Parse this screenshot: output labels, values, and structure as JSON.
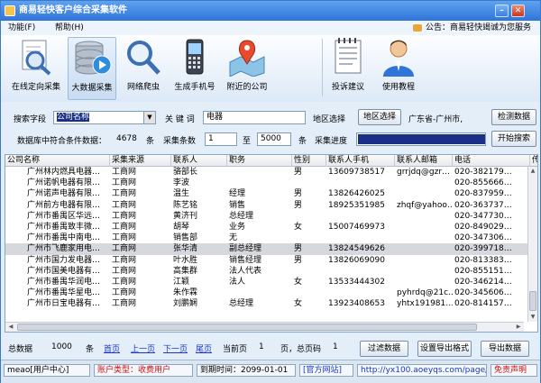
{
  "window": {
    "title": "商易轻快客户综合采集软件"
  },
  "menu": {
    "function": "功能(F)",
    "help": "帮助(H)"
  },
  "notice": "公告：商易轻快竭诚为您服务",
  "toolbar": [
    {
      "label": "在线定向采集",
      "icon": "magnifier-document-icon"
    },
    {
      "label": "大数据采集",
      "icon": "database-play-icon"
    },
    {
      "label": "网络爬虫",
      "icon": "magnifier-icon"
    },
    {
      "label": "生成手机号",
      "icon": "phone-icon"
    },
    {
      "label": "附近的公司",
      "icon": "map-location-icon"
    },
    {
      "label": "投诉建议",
      "icon": "notepad-icon"
    },
    {
      "label": "使用教程",
      "icon": "person-icon"
    }
  ],
  "search": {
    "field_label": "搜索字段",
    "field_value": "公司名称",
    "keyword_label": "关 键 词",
    "keyword_value": "电器",
    "region_label": "地区选择",
    "region_button": "地区选择",
    "region_value": "广东省-广州市,",
    "check_button": "检测数据",
    "db_count_label": "数据库中符合条件数据：",
    "db_count": "4678",
    "unit": "条",
    "count_label": "采集条数",
    "range_from": "1",
    "to_label": "至",
    "range_to": "5000",
    "progress_label": "采集进度",
    "progress": 1.0,
    "start_button": "开始搜索"
  },
  "table": {
    "columns": [
      "公司名称",
      "采集来源",
      "联系人",
      "职务",
      "性别",
      "联系人手机",
      "联系人邮箱",
      "电话",
      "传"
    ],
    "rows": [
      [
        "广州林内燃具电器…",
        "工商网",
        "骆部长",
        "",
        "男",
        "13609738517",
        "grrjdq@gzr…",
        "020-382179…",
        ""
      ],
      [
        "广州诺帆电器有限…",
        "工商网",
        "李波",
        "",
        "",
        "",
        "",
        "020-855666…",
        ""
      ],
      [
        "广州诺声电器有限…",
        "工商网",
        "温生",
        "经理",
        "男",
        "13826426025",
        "",
        "020-837959…",
        ""
      ],
      [
        "广州前方电器有限…",
        "工商网",
        "陈艺铭",
        "销售",
        "男",
        "18925351985",
        "zhqf@yahoo…",
        "020-363737…",
        ""
      ],
      [
        "广州市番禺区华远…",
        "工商网",
        "黄济刊",
        "总经理",
        "",
        "",
        "",
        "020-347730…",
        ""
      ],
      [
        "广州市番禺致丰微…",
        "工商网",
        "胡琴",
        "业务",
        "女",
        "15007469973",
        "",
        "020-849029…",
        ""
      ],
      [
        "广州市番禺中南电…",
        "工商网",
        "销售部",
        "无",
        "",
        "",
        "",
        "020-347306…",
        ""
      ],
      [
        "广州市飞鹿家用电…",
        "工商网",
        "张华清",
        "副总经理",
        "男",
        "13824549626",
        "",
        "020-399718…",
        ""
      ],
      [
        "广州市国力发电器…",
        "工商网",
        "叶水胜",
        "销售经理",
        "男",
        "13826069090",
        "",
        "020-813383…",
        ""
      ],
      [
        "广州市国美电器有…",
        "工商网",
        "高集群",
        "法人代表",
        "",
        "",
        "",
        "020-855151…",
        ""
      ],
      [
        "广州市番禺华润电…",
        "工商网",
        "江颖",
        "法人",
        "女",
        "13533444302",
        "",
        "020-346214…",
        ""
      ],
      [
        "广州市番禺华星电…",
        "工商网",
        "朱作霖",
        "",
        "",
        "",
        "pyhrdq@21c…",
        "020-345606…",
        ""
      ],
      [
        "广州市日宝电器有…",
        "工商网",
        "刘鹏娴",
        "总经理",
        "女",
        "13923408653",
        "yhtx191981…",
        "020-814157…",
        ""
      ]
    ],
    "highlight_row": 7
  },
  "pager": {
    "total_label": "总数据",
    "total": "1000",
    "unit": "条",
    "first": "首页",
    "prev": "上一页",
    "next": "下一页",
    "last": "尾页",
    "current_label": "当前页",
    "current": "1",
    "page_unit": "页，总页码",
    "pages": "1",
    "filter_button": "过滤数据",
    "export_setting_button": "设置导出格式",
    "export_button": "导出数据"
  },
  "status": {
    "user": "meao[用户中心]",
    "account_type": "账户类型：收费用户",
    "expire": "到期时间：2099-01-01",
    "official": "[官方网站]",
    "url": "http://yx100.aoeyqs.com/page/32.",
    "disclaimer": "免责声明"
  },
  "colors": {
    "title": "#2f74d8",
    "accent": "#1a2f86",
    "red": "#d01010",
    "link": "#1a37c8"
  }
}
